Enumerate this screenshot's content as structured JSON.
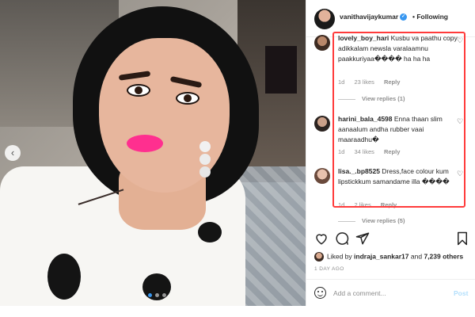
{
  "post": {
    "username": "vanithavijaykumar",
    "verified_symbol": "✓",
    "following_label": "• Following",
    "prev_symbol": "‹",
    "carousel_count": 4,
    "carousel_active": 1
  },
  "comments": [
    {
      "username": "lovely_boy_hari",
      "text": "Kusbu va paathu copy adikkalam newsla varalaamnu paakkuriyaa���� ha ha ha",
      "time": "1d",
      "likes": "23 likes",
      "reply_label": "Reply",
      "view_replies": "View replies (1)"
    },
    {
      "username": "harini_bala_4598",
      "text": "Enna thaan slim aanaalum andha rubber vaai maaraadhu�",
      "time": "1d",
      "likes": "34 likes",
      "reply_label": "Reply"
    },
    {
      "username": "lisa._.bp8525",
      "text": "Dress,face colour kum lipstickkum samandame illa ����",
      "time": "1d",
      "likes": "2 likes",
      "reply_label": "Reply",
      "view_replies": "View replies (5)"
    }
  ],
  "likes": {
    "prefix": "Liked by",
    "user": "indraja_sankar17",
    "middle": "and",
    "count": "7,239 others"
  },
  "time_ago": "1 DAY AGO",
  "add_comment": {
    "placeholder": "Add a comment...",
    "post_label": "Post"
  },
  "icons": {
    "like": "heart-outline-icon",
    "comment": "comment-bubble-icon",
    "share": "paper-plane-icon",
    "save": "bookmark-icon",
    "comment_like": "small-heart-icon",
    "emoji": "smiley-icon"
  },
  "colors": {
    "highlight": "#ff3b3b",
    "verified": "#3897f0",
    "post_disabled": "#b2dffc",
    "lips": "#ff2f8f"
  }
}
